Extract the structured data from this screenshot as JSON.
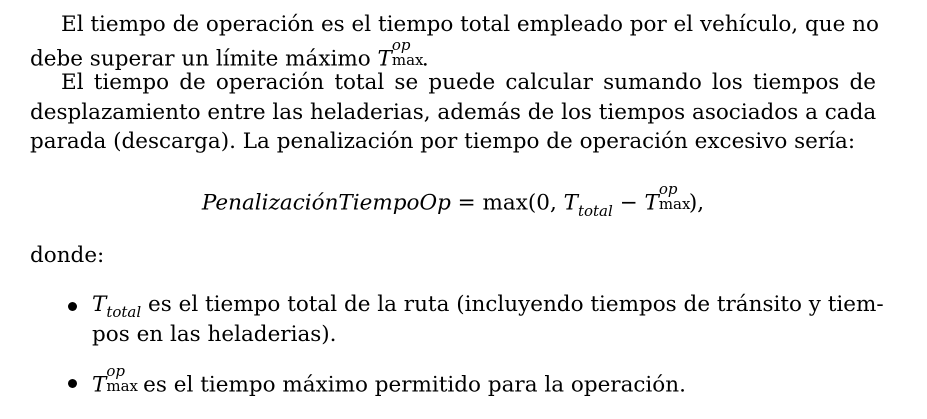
{
  "para1": {
    "line1": "El tiempo de operación es el tiempo total empleado por el vehículo, que no",
    "line2_text": "debe superar un límite máximo ",
    "line2_T": "T",
    "line2_sup": "op",
    "line2_sub": "max",
    "line2_end": "."
  },
  "para2": {
    "line1": "El tiempo de operación total se puede calcular sumando los tiempos de",
    "line2": "desplazamiento entre las heladerias, además de los tiempos asociados a cada",
    "line3": "parada (descarga). La penalización por tiempo de operación excesivo sería:"
  },
  "equation": {
    "lhs": "PenalizaciónTiempoOp",
    "eq": " = ",
    "fn": "max",
    "open": "(0, ",
    "T1": "T",
    "T1_sub": "total",
    "minus": " − ",
    "T2": "T",
    "T2_sup": "op",
    "T2_sub": "max",
    "close": "),"
  },
  "donde": "donde:",
  "bullets": [
    {
      "sym": "T",
      "sym_sub": "total",
      "line1": " es el tiempo total de la ruta (incluyendo tiempos de tránsito y tiem-",
      "line2": "pos en las heladerias)."
    },
    {
      "sym": "T",
      "sym_sup": "op",
      "sym_sub": "max",
      "line1": " es el tiempo máximo permitido para la operación."
    }
  ]
}
